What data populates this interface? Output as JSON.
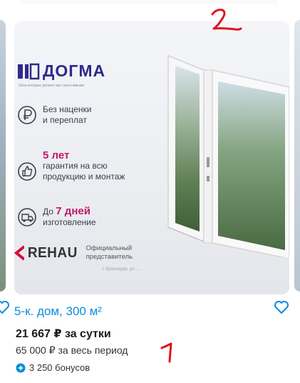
{
  "listing": {
    "title": "5-к. дом, 300 м²",
    "price": "21 667 ₽ за сутки",
    "period_price": "65 000 ₽ за весь период",
    "bonus": "3 250 бонусов"
  },
  "ad_image": {
    "brand": "ДОГМА",
    "slogan": "Окна которые делают вас счастливыми",
    "feature_1": {
      "line1": "Без наценки",
      "line2": "и переплат"
    },
    "feature_2": {
      "accent": "5 лет",
      "line1": "гарантия на всю",
      "line2": "продукцию и монтаж"
    },
    "feature_3": {
      "prefix": "До ",
      "accent": "7 дней",
      "line2": "изготовление"
    },
    "partner": "REHAU",
    "partner_caption": {
      "line1": "Официальный",
      "line2": "представитель"
    },
    "note": "г. Краснодар, ул. ..."
  },
  "annotations": {
    "mark_top": "2",
    "mark_bottom": "1"
  },
  "colors": {
    "title_link": "#0a8ce0",
    "brand": "#2e2b8a",
    "accent": "#c2186b",
    "annotation": "#e0141e",
    "heart": "#0a8ce0"
  }
}
